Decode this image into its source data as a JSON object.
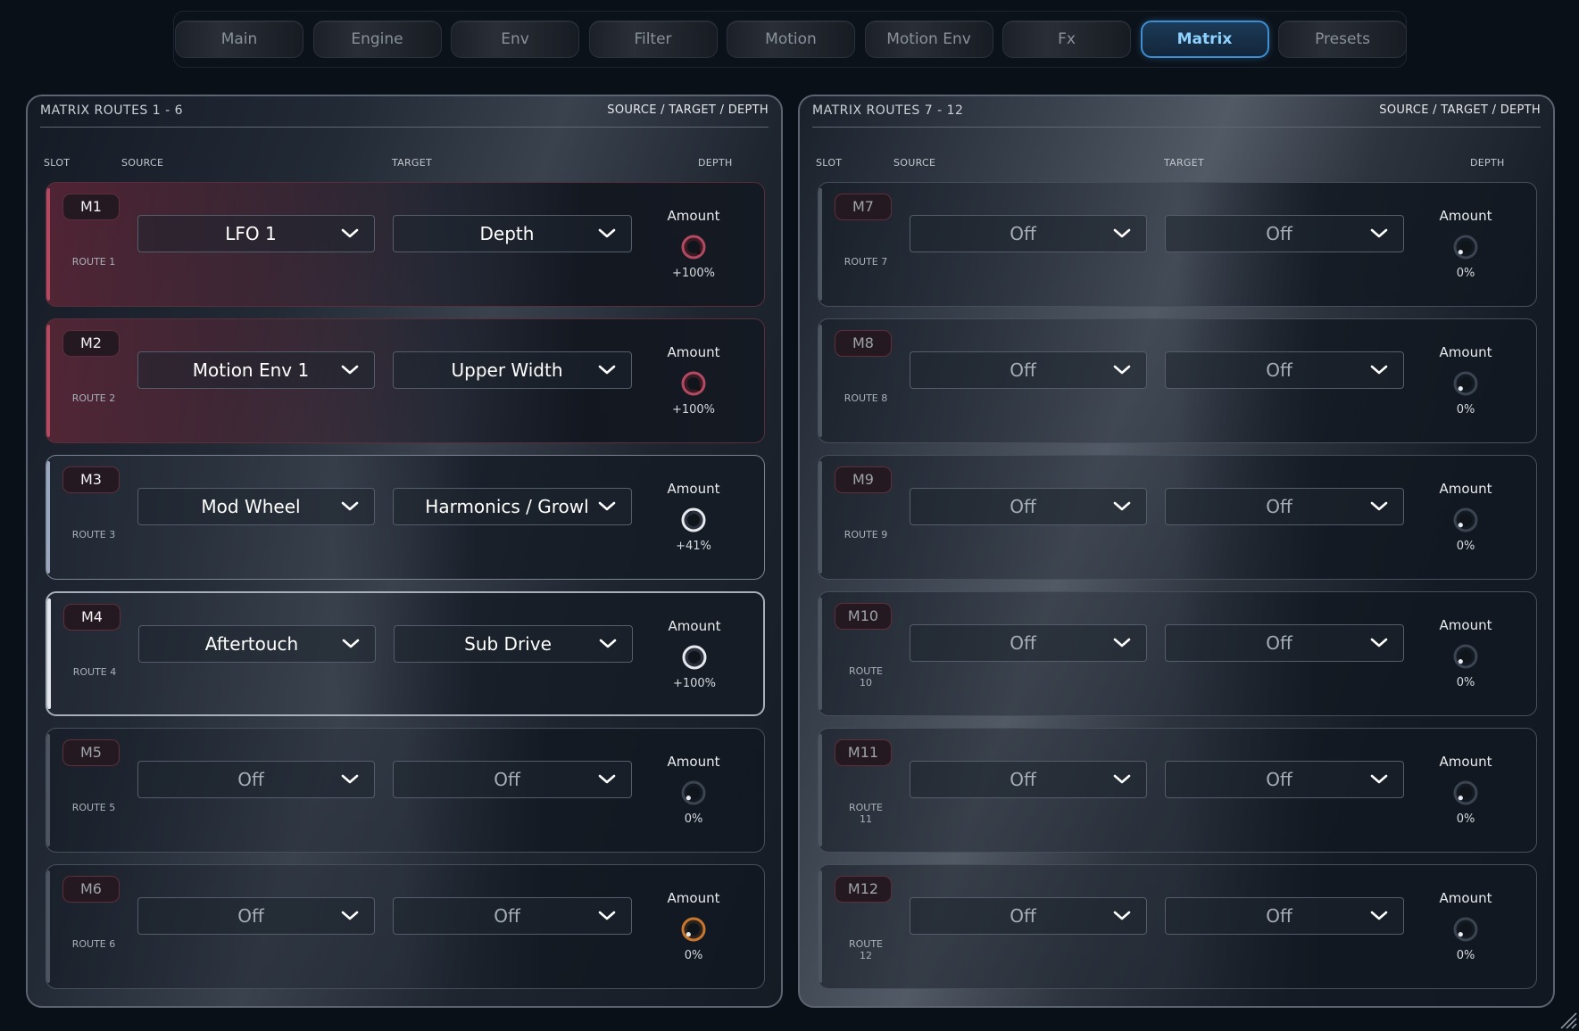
{
  "tabs": [
    {
      "label": "Main",
      "active": false
    },
    {
      "label": "Engine",
      "active": false
    },
    {
      "label": "Env",
      "active": false
    },
    {
      "label": "Filter",
      "active": false
    },
    {
      "label": "Motion",
      "active": false
    },
    {
      "label": "Motion Env",
      "active": false
    },
    {
      "label": "Fx",
      "active": false
    },
    {
      "label": "Matrix",
      "active": true
    },
    {
      "label": "Presets",
      "active": false
    }
  ],
  "columns": {
    "slot": "SLOT",
    "source": "SOURCE",
    "target": "TARGET",
    "depth": "DEPTH"
  },
  "amount_label": "Amount",
  "colors": {
    "accent": "#3e8ed1",
    "route_active": "#b44a62",
    "route_off": "#4d5560",
    "knob_orange": "#c9772f"
  },
  "panels": [
    {
      "title": "MATRIX ROUTES 1 - 6",
      "subtitle": "SOURCE / TARGET / DEPTH",
      "routes": [
        {
          "slot": "M1",
          "route": "ROUTE 1",
          "source": "LFO 1",
          "target": "Depth",
          "amount": "+100%",
          "amount_value": 1.0,
          "state": "red"
        },
        {
          "slot": "M2",
          "route": "ROUTE 2",
          "source": "Motion Env 1",
          "target": "Upper Width",
          "amount": "+100%",
          "amount_value": 1.0,
          "state": "red"
        },
        {
          "slot": "M3",
          "route": "ROUTE 3",
          "source": "Mod Wheel",
          "target": "Harmonics / Growl",
          "amount": "+41%",
          "amount_value": 0.41,
          "state": "active-grey"
        },
        {
          "slot": "M4",
          "route": "ROUTE 4",
          "source": "Aftertouch",
          "target": "Sub Drive",
          "amount": "+100%",
          "amount_value": 1.0,
          "state": "active-white"
        },
        {
          "slot": "M5",
          "route": "ROUTE 5",
          "source": "Off",
          "target": "Off",
          "amount": "0%",
          "amount_value": 0,
          "state": "off"
        },
        {
          "slot": "M6",
          "route": "ROUTE 6",
          "source": "Off",
          "target": "Off",
          "amount": "0%",
          "amount_value": 0,
          "state": "off-orange"
        }
      ]
    },
    {
      "title": "MATRIX ROUTES 7 - 12",
      "subtitle": "SOURCE / TARGET / DEPTH",
      "routes": [
        {
          "slot": "M7",
          "route": "ROUTE 7",
          "source": "Off",
          "target": "Off",
          "amount": "0%",
          "amount_value": 0,
          "state": "off"
        },
        {
          "slot": "M8",
          "route": "ROUTE 8",
          "source": "Off",
          "target": "Off",
          "amount": "0%",
          "amount_value": 0,
          "state": "off"
        },
        {
          "slot": "M9",
          "route": "ROUTE 9",
          "source": "Off",
          "target": "Off",
          "amount": "0%",
          "amount_value": 0,
          "state": "off"
        },
        {
          "slot": "M10",
          "route": "ROUTE 10",
          "source": "Off",
          "target": "Off",
          "amount": "0%",
          "amount_value": 0,
          "state": "off"
        },
        {
          "slot": "M11",
          "route": "ROUTE 11",
          "source": "Off",
          "target": "Off",
          "amount": "0%",
          "amount_value": 0,
          "state": "off"
        },
        {
          "slot": "M12",
          "route": "ROUTE 12",
          "source": "Off",
          "target": "Off",
          "amount": "0%",
          "amount_value": 0,
          "state": "off"
        }
      ]
    }
  ]
}
